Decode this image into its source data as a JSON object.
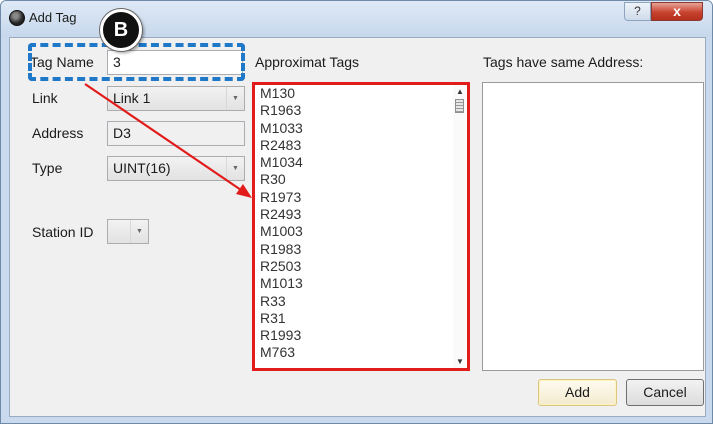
{
  "window": {
    "title": "Add Tag",
    "help_label": "?",
    "close_label": "x"
  },
  "annotation": {
    "badge_label": "B",
    "box_color": "#1f78c8",
    "highlight_color": "#e21b1b"
  },
  "form": {
    "tag_name_label": "Tag Name",
    "tag_name_value": "3",
    "link_label": "Link",
    "link_value": "Link 1",
    "address_label": "Address",
    "address_value": "D3",
    "type_label": "Type",
    "type_value": "UINT(16)",
    "station_id_label": "Station ID",
    "station_id_value": ""
  },
  "approx_tags": {
    "header": "Approximat Tags",
    "items": [
      "M130",
      "R1963",
      "M1033",
      "R2483",
      "M1034",
      "R30",
      "R1973",
      "R2493",
      "M1003",
      "R1983",
      "R2503",
      "M1013",
      "R33",
      "R31",
      "R1993",
      "M763"
    ]
  },
  "same_address": {
    "header": "Tags have same Address:",
    "items": []
  },
  "buttons": {
    "add_label": "Add",
    "cancel_label": "Cancel"
  }
}
